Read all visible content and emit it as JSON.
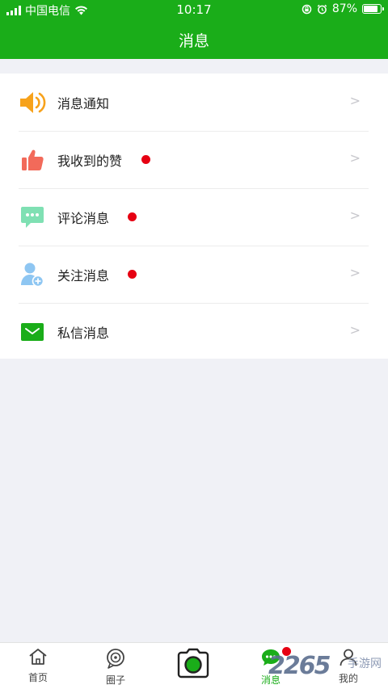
{
  "status_bar": {
    "carrier": "中国电信",
    "time": "10:17",
    "battery": "87%",
    "battery_level": 0.87
  },
  "header": {
    "title": "消息"
  },
  "colors": {
    "brand_green": "#1aad19",
    "badge_red": "#e60012",
    "notice_orange": "#f7a21b",
    "like_red": "#f26a5a",
    "comment_green": "#7fe0b3",
    "follow_blue": "#8ec6f2"
  },
  "messages": {
    "items": [
      {
        "label": "消息通知",
        "icon": "speaker-icon",
        "badge": false
      },
      {
        "label": "我收到的赞",
        "icon": "thumbs-up-icon",
        "badge": true
      },
      {
        "label": "评论消息",
        "icon": "comment-bubble-icon",
        "badge": true
      },
      {
        "label": "关注消息",
        "icon": "user-add-icon",
        "badge": true
      },
      {
        "label": "私信消息",
        "icon": "envelope-icon",
        "badge": false
      }
    ],
    "chevron": ">"
  },
  "tabbar": {
    "tabs": [
      {
        "label": "首页",
        "icon": "home-icon",
        "active": false
      },
      {
        "label": "圈子",
        "icon": "circle-icon",
        "active": false
      },
      {
        "label": "",
        "icon": "camera-icon",
        "active": false
      },
      {
        "label": "消息",
        "icon": "chat-icon",
        "active": true,
        "badge": true
      },
      {
        "label": "我的",
        "icon": "user-icon",
        "active": false
      }
    ]
  },
  "watermark": {
    "number": "2265",
    "text": "手游网"
  }
}
